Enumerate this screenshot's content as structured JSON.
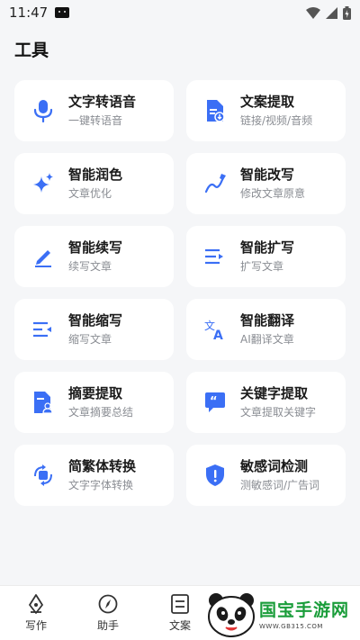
{
  "status": {
    "time": "11:47"
  },
  "header": {
    "title": "工具"
  },
  "accent": "#3b6ff5",
  "tools": [
    {
      "title": "文字转语音",
      "subtitle": "一键转语音",
      "icon": "microphone-icon"
    },
    {
      "title": "文案提取",
      "subtitle": "链接/视频/音频",
      "icon": "document-download-icon"
    },
    {
      "title": "智能润色",
      "subtitle": "文章优化",
      "icon": "sparkle-icon"
    },
    {
      "title": "智能改写",
      "subtitle": "修改文章原意",
      "icon": "pen-curve-icon"
    },
    {
      "title": "智能续写",
      "subtitle": "续写文章",
      "icon": "edit-pencil-icon"
    },
    {
      "title": "智能扩写",
      "subtitle": "扩写文章",
      "icon": "expand-lines-icon"
    },
    {
      "title": "智能缩写",
      "subtitle": "缩写文章",
      "icon": "shrink-lines-icon"
    },
    {
      "title": "智能翻译",
      "subtitle": "AI翻译文章",
      "icon": "translate-icon"
    },
    {
      "title": "摘要提取",
      "subtitle": "文章摘要总结",
      "icon": "document-user-icon"
    },
    {
      "title": "关键字提取",
      "subtitle": "文章提取关键字",
      "icon": "quote-bubble-icon"
    },
    {
      "title": "简繁体转换",
      "subtitle": "文字字体转换",
      "icon": "convert-icon"
    },
    {
      "title": "敏感词检测",
      "subtitle": "测敏感词/广告词",
      "icon": "shield-alert-icon"
    }
  ],
  "nav": [
    {
      "label": "写作",
      "icon": "pen-nib-icon"
    },
    {
      "label": "助手",
      "icon": "compass-icon"
    },
    {
      "label": "文案",
      "icon": "document-list-icon"
    }
  ],
  "watermark": {
    "brand": "国宝手游网",
    "url": "WWW.GB315.COM"
  }
}
